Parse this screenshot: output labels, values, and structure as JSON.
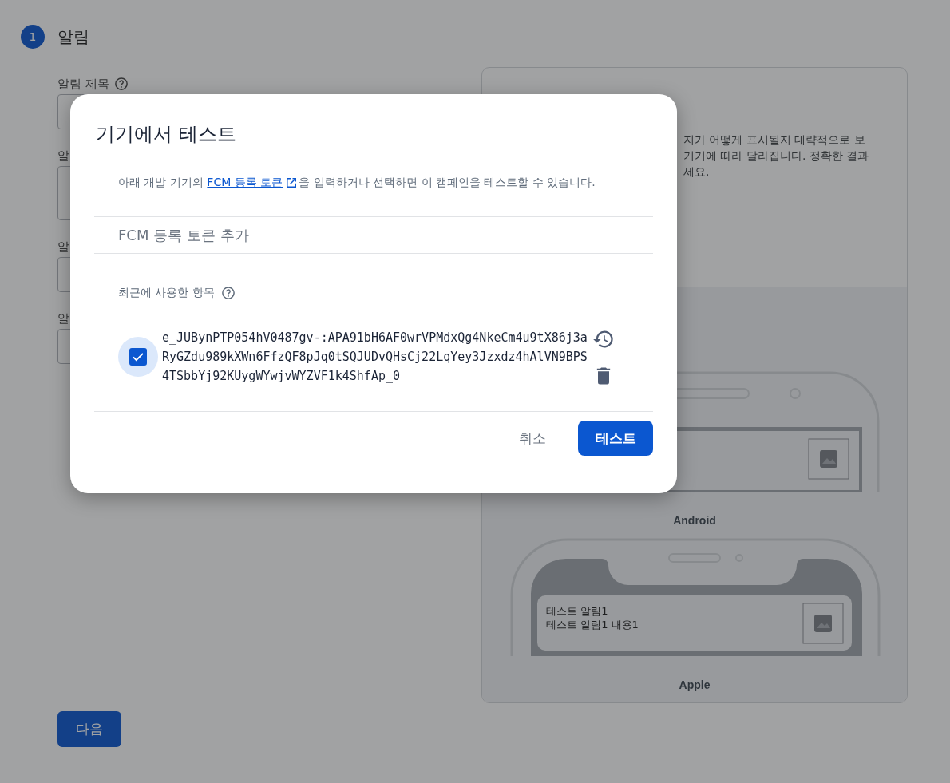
{
  "page": {
    "step": {
      "number": "1",
      "title": "알림"
    },
    "form": [
      {
        "label": "알림 제목",
        "help": true,
        "kind": "input"
      },
      {
        "label": "알",
        "help": false,
        "kind": "textarea"
      },
      {
        "label": "알",
        "help": false,
        "kind": "input"
      },
      {
        "label": "알",
        "help": false,
        "kind": "input"
      }
    ],
    "next_button": "다음",
    "preview": {
      "description": [
        "지가 어떻게 표시될지 대략적으로 보",
        "기기에 따라 달라집니다. 정확한 결과",
        "세요."
      ],
      "devices": [
        {
          "kind": "android",
          "label": "Android"
        },
        {
          "kind": "apple",
          "label": "Apple",
          "notification": {
            "title": "테스트 알림1",
            "body": "테스트 알림1 내용1"
          }
        }
      ]
    }
  },
  "dialog": {
    "title": "기기에서 테스트",
    "description": {
      "before": "아래 개발 기기의 ",
      "link": "FCM 등록 토큰",
      "after": "을 입력하거나 선택하면 이 캠페인을 테스트할 수 있습니다."
    },
    "token_field": {
      "placeholder": "FCM 등록 토큰 추가"
    },
    "recent_label": "최근에 사용한 항목",
    "tokens": [
      {
        "lines": [
          "e_JUBynPTP054hV0487gv-:APA91bH6AF0wrVPMdxQg4NkeCm4u9tX86j3a",
          "RyGZdu989kXWn6FfzQF8pJq0tSQJUDvQHsCj22LqYey3Jzxdz4hAlVN9BPS",
          "4TSbbYj92KUygWYwjvWYZVF1k4ShfAp_0"
        ],
        "checked": true
      }
    ],
    "buttons": [
      {
        "label": "취소",
        "kind": "text"
      },
      {
        "label": "테스트",
        "kind": "primary"
      }
    ]
  }
}
